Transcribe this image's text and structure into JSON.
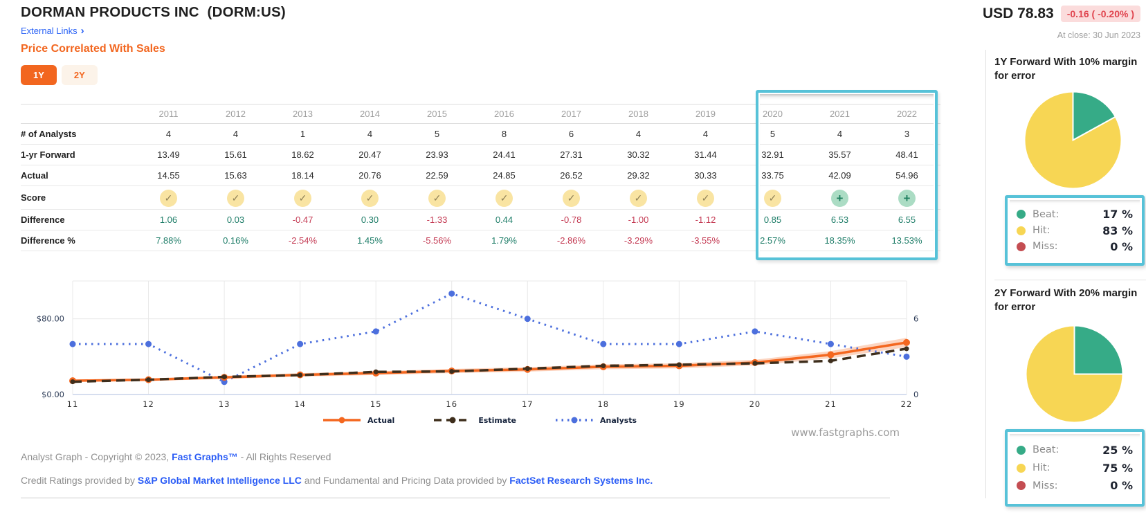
{
  "header": {
    "title": "DORMAN PRODUCTS INC  (DORM:US)",
    "external_links_label": "External Links",
    "subtitle": "Price Correlated With Sales",
    "range_buttons": [
      {
        "label": "1Y",
        "active": true
      },
      {
        "label": "2Y",
        "active": false
      }
    ],
    "price_label": "USD 78.83",
    "price_change": "-0.16 ( -0.20% )",
    "at_close": "At close: 30 Jun 2023"
  },
  "icons": {
    "chevron_right": "›",
    "check": "✓",
    "plus": "+"
  },
  "table": {
    "years": [
      "2011",
      "2012",
      "2013",
      "2014",
      "2015",
      "2016",
      "2017",
      "2018",
      "2019",
      "2020",
      "2021",
      "2022"
    ],
    "rows": [
      {
        "label": "# of Analysts",
        "values": [
          "4",
          "4",
          "1",
          "4",
          "5",
          "8",
          "6",
          "4",
          "4",
          "5",
          "4",
          "3"
        ]
      },
      {
        "label": "1-yr Forward",
        "values": [
          "13.49",
          "15.61",
          "18.62",
          "20.47",
          "23.93",
          "24.41",
          "27.31",
          "30.32",
          "31.44",
          "32.91",
          "35.57",
          "48.41"
        ]
      },
      {
        "label": "Actual",
        "values": [
          "14.55",
          "15.63",
          "18.14",
          "20.76",
          "22.59",
          "24.85",
          "26.52",
          "29.32",
          "30.33",
          "33.75",
          "42.09",
          "54.96"
        ]
      },
      {
        "label": "Score",
        "icons": [
          "check",
          "check",
          "check",
          "check",
          "check",
          "check",
          "check",
          "check",
          "check",
          "check",
          "plus",
          "plus"
        ]
      },
      {
        "label": "Difference",
        "colored": true,
        "values": [
          "1.06",
          "0.03",
          "-0.47",
          "0.30",
          "-1.33",
          "0.44",
          "-0.78",
          "-1.00",
          "-1.12",
          "0.85",
          "6.53",
          "6.55"
        ]
      },
      {
        "label": "Difference %",
        "colored": true,
        "values": [
          "7.88%",
          "0.16%",
          "-2.54%",
          "1.45%",
          "-5.56%",
          "1.79%",
          "-2.86%",
          "-3.29%",
          "-3.55%",
          "2.57%",
          "18.35%",
          "13.53%"
        ]
      }
    ],
    "highlight_years": [
      "2020",
      "2021",
      "2022"
    ]
  },
  "chart_data": [
    {
      "type": "line",
      "title": "",
      "xlabel": "",
      "ylabel": "",
      "x": [
        11,
        12,
        13,
        14,
        15,
        16,
        17,
        18,
        19,
        20,
        21,
        22
      ],
      "series": [
        {
          "name": "Actual",
          "values": [
            14.55,
            15.63,
            18.14,
            20.76,
            22.59,
            24.85,
            26.52,
            29.32,
            30.33,
            33.75,
            42.09,
            54.96
          ],
          "color": "#f4671f",
          "style": "solid",
          "axis": "left",
          "band_pct": 0.09
        },
        {
          "name": "Estimate",
          "values": [
            13.49,
            15.61,
            18.62,
            20.47,
            23.93,
            24.41,
            27.31,
            30.32,
            31.44,
            32.91,
            35.57,
            48.41
          ],
          "color": "#3e2e1c",
          "style": "dashed",
          "axis": "left"
        },
        {
          "name": "Analysts",
          "values": [
            4,
            4,
            1,
            4,
            5,
            8,
            6,
            4,
            4,
            5,
            4,
            3
          ],
          "color": "#4c6fdd",
          "style": "dotted",
          "axis": "right"
        }
      ],
      "left_axis": {
        "max": 120,
        "ticks": [
          {
            "value": 0,
            "label": "$0.00"
          },
          {
            "value": 80,
            "label": "$80.00"
          }
        ]
      },
      "right_axis": {
        "max": 9,
        "ticks": [
          {
            "value": 0,
            "label": "0"
          },
          {
            "value": 6,
            "label": "6"
          }
        ]
      },
      "grid": true,
      "legend_position": "bottom"
    },
    {
      "type": "pie",
      "title": "1Y Forward With 10% margin for error",
      "slices": [
        {
          "label": "Beat",
          "value": 17,
          "color": "#36ab87"
        },
        {
          "label": "Hit",
          "value": 83,
          "color": "#f7d654"
        },
        {
          "label": "Miss",
          "value": 0,
          "color": "#c44d52"
        }
      ]
    },
    {
      "type": "pie",
      "title": "2Y Forward With 20% margin for error",
      "slices": [
        {
          "label": "Beat",
          "value": 25,
          "color": "#36ab87"
        },
        {
          "label": "Hit",
          "value": 75,
          "color": "#f7d654"
        },
        {
          "label": "Miss",
          "value": 0,
          "color": "#c44d52"
        }
      ]
    }
  ],
  "footer": {
    "watermark": "www.fastgraphs.com",
    "line1_prefix": "Analyst Graph - Copyright © 2023, ",
    "line1_link": "Fast Graphs™",
    "line1_suffix": " - All Rights Reserved",
    "line2_prefix": "Credit Ratings provided by ",
    "line2_link1": "S&P Global Market Intelligence LLC",
    "line2_mid": " and Fundamental and Pricing Data provided by ",
    "line2_link2": "FactSet Research Systems Inc."
  },
  "colors": {
    "accent_orange": "#f2661f",
    "link_blue": "#2a5cf6",
    "positive_green": "#1e7d68",
    "negative_red": "#c43a53",
    "highlight_cyan": "#57c2d8",
    "beat_green": "#36ab87",
    "hit_yellow": "#f7d654",
    "miss_red": "#c44d52",
    "price_change_red": "#e0454f",
    "estimate_dark": "#3e2e1c",
    "analysts_blue": "#4c6fdd"
  }
}
